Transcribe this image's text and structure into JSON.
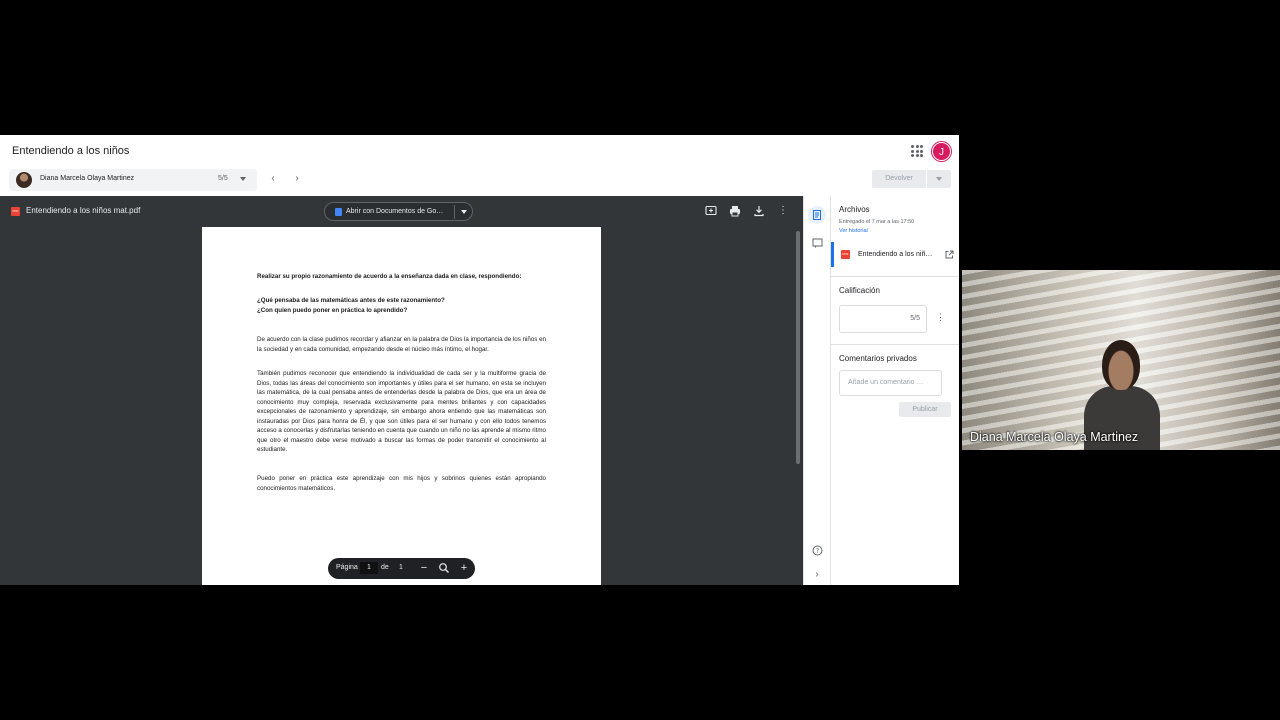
{
  "app": {
    "title": "Entendiendo a los niños",
    "user_initial": "J"
  },
  "student": {
    "name": "Diana Marcela Olaya Martinez",
    "count": "5/5"
  },
  "actions": {
    "return_label": "Devolver"
  },
  "viewer": {
    "file_name": "Entendiendo a los niños mat.pdf",
    "open_with": "Abrir con Documentos de Go…",
    "pdf_badge": "PDF",
    "page": {
      "heading1": "Realizar su propio razonamiento de acuerdo a la enseñanza dada en clase, respondiendo:",
      "question1": "¿Qué pensaba de las matemáticas antes de este razonamiento?",
      "question2": "¿Con quien puedo poner en práctica lo aprendido?",
      "p1": "De acuerdo con la clase pudimos recordar y afianzar en la palabra de Dios la importancia de los niños en la sociedad y en cada comunidad, empezando desde el núcleo más íntimo, el hogar.",
      "p2": "También pudimos reconocer que entendiendo la individualidad de cada ser y la multiforme gracia de Dios, todas las áreas del conocimiento son importantes y útiles para el ser humano, en esta se incluyen las matemática, de la cual pensaba antes de entenderlas desde la palabra de Dios, que era un área de conocimiento muy compleja, reservada exclusivamente para mentes brillantes y con capacidades excepcionales de razonamiento y aprendizaje, sin embargo ahora entiendo que las matemáticas son instauradas por Dios para honra de Él, y que son útiles para el ser humano y con ello todos tenemos acceso a conocerlas y disfrutarlas teniendo en cuenta que cuando un niño no las aprende al mismo ritmo que otro el maestro debe verse motivado a buscar las formas de poder transmitir el conocimiento al estudiante.",
      "p3": "Puedo poner en práctica este aprendizaje con mis hijos y sobrinos quienes están apropiando conocimientos matemáticos."
    },
    "pager": {
      "label": "Página",
      "current": "1",
      "of": "de",
      "total": "1"
    }
  },
  "panel": {
    "files_heading": "Archivos",
    "submitted": "Entregado el 7 mar a las 17:50",
    "history_link": "Ver historial",
    "attachment": "Entendiendo a los niñ…",
    "grade_heading": "Calificación",
    "grade_value": "5/5",
    "comments_heading": "Comentarios privados",
    "comment_placeholder": "Añade un comentario …",
    "publish_label": "Publicar"
  },
  "webcam": {
    "participant_name": "Diana Marcela Olaya Martinez"
  },
  "colors": {
    "accent": "#1a73e8",
    "avatar": "#d81b60",
    "pdf_red": "#ea4335",
    "viewer_bg": "#323639"
  }
}
